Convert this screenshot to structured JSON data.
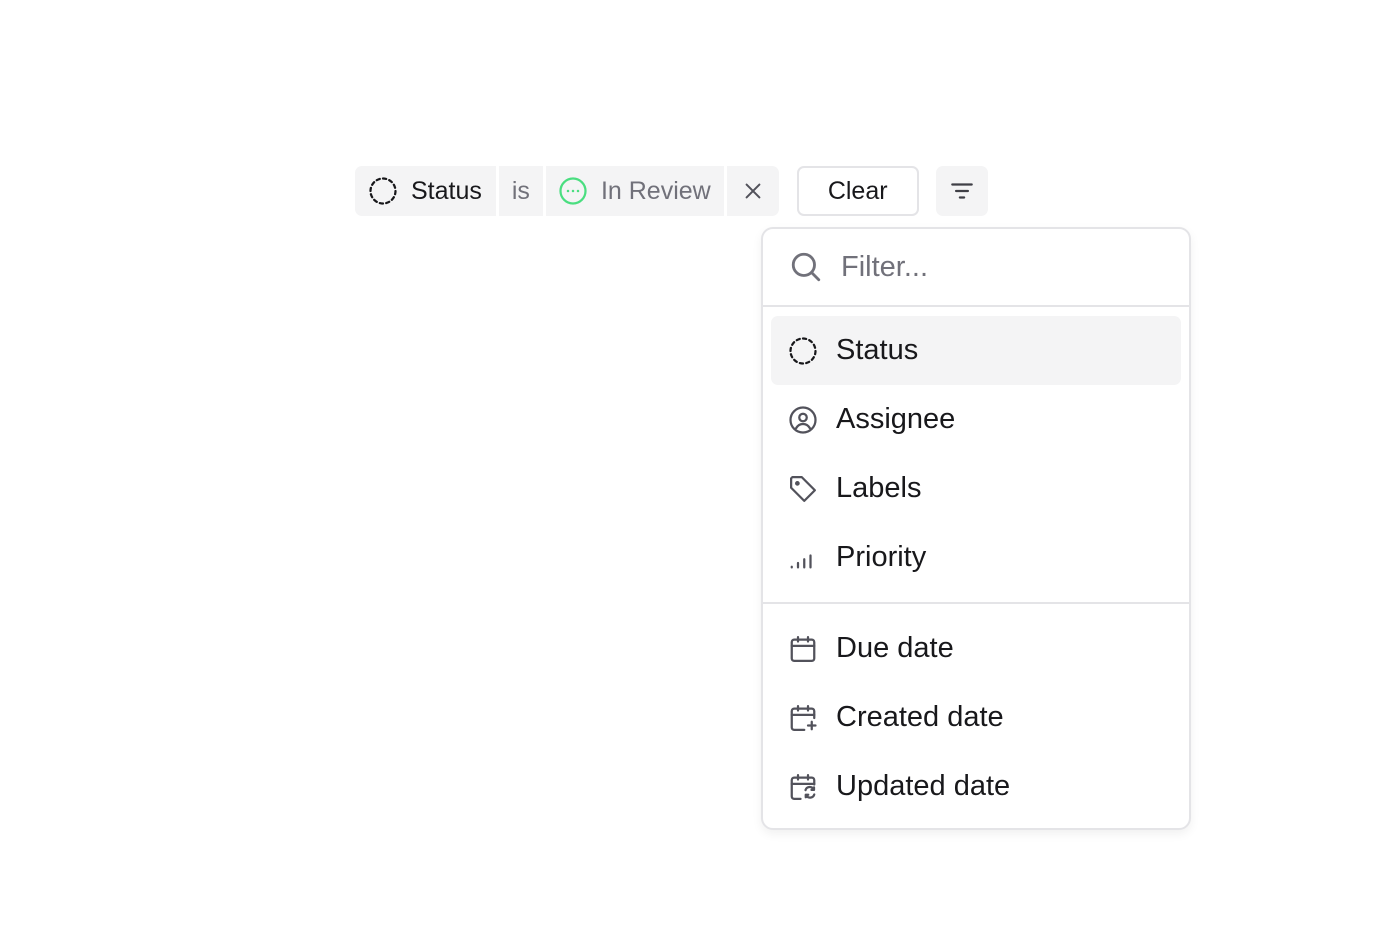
{
  "filter_chip": {
    "field_label": "Status",
    "field_icon": "dashed-circle-icon",
    "operator": "is",
    "value_label": "In Review",
    "value_icon": "in-review-circle-icon",
    "value_color": "#4ade80",
    "remove_icon": "close-icon"
  },
  "toolbar": {
    "clear_label": "Clear",
    "filter_icon": "filter-lines-icon"
  },
  "dropdown": {
    "search_placeholder": "Filter...",
    "search_icon": "search-icon",
    "groups": [
      {
        "items": [
          {
            "label": "Status",
            "icon": "dashed-circle-icon",
            "active": true
          },
          {
            "label": "Assignee",
            "icon": "user-circle-icon"
          },
          {
            "label": "Labels",
            "icon": "tag-icon"
          },
          {
            "label": "Priority",
            "icon": "signal-bars-icon"
          }
        ]
      },
      {
        "items": [
          {
            "label": "Due date",
            "icon": "calendar-icon"
          },
          {
            "label": "Created date",
            "icon": "calendar-plus-icon"
          },
          {
            "label": "Updated date",
            "icon": "calendar-sync-icon"
          }
        ]
      }
    ]
  },
  "colors": {
    "chip_bg": "#f4f4f5",
    "border": "#e4e4e7",
    "muted_text": "#71717a",
    "text": "#18181b",
    "active_item_bg": "#f4f4f5"
  }
}
